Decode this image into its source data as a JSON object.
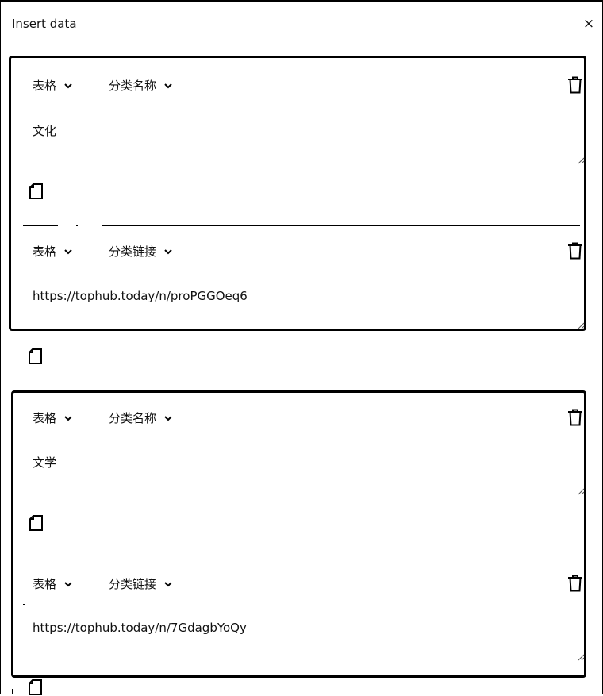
{
  "dialog": {
    "title": "Insert data",
    "close_label": "×"
  },
  "groups": [
    {
      "rows": [
        {
          "type_label": "表格",
          "field_label": "分类名称",
          "value": "文化"
        },
        {
          "type_label": "表格",
          "field_label": "分类链接",
          "value": "https://tophub.today/n/proPGGOeq6"
        }
      ]
    },
    {
      "rows": [
        {
          "type_label": "表格",
          "field_label": "分类名称",
          "value": "文学"
        },
        {
          "type_label": "表格",
          "field_label": "分类链接",
          "value": "https://tophub.today/n/7GdagbYoQy"
        }
      ]
    }
  ],
  "icons": {
    "close": "close-icon",
    "chevron": "chevron-down-icon",
    "trash": "trash-icon",
    "document": "document-icon",
    "resize": "resize-handle-icon"
  }
}
